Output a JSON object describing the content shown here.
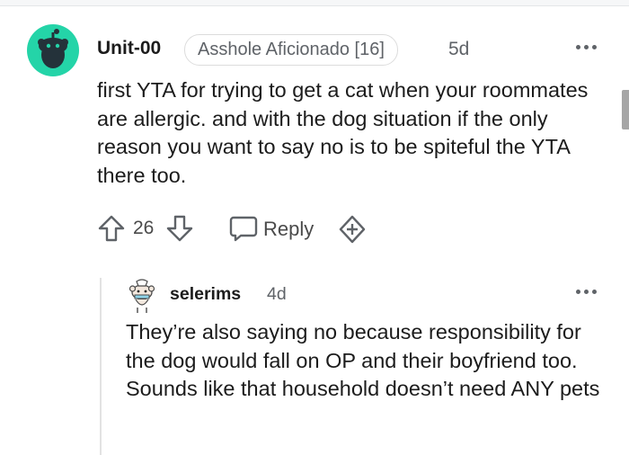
{
  "comment": {
    "username": "Unit-00",
    "flair": "Asshole Aficionado [16]",
    "age": "5d",
    "text": "first YTA for trying to get a cat when your roommates are allergic. and with the dog situation if the only reason you want to say no is to be spiteful the YTA there too.",
    "votes": "26",
    "reply_label": "Reply",
    "avatar_color": "#24d4a8"
  },
  "reply": {
    "username": "selerims",
    "age": "4d",
    "text": "They’re also saying no because responsibility for the dog would fall on OP and their boyfriend too. Sounds like that household doesn’t need ANY pets"
  },
  "icons": [
    "upvote-icon",
    "downvote-icon",
    "reply-bubble-icon",
    "award-plus-icon",
    "more-options-icon",
    "snoo-avatar-icon"
  ]
}
